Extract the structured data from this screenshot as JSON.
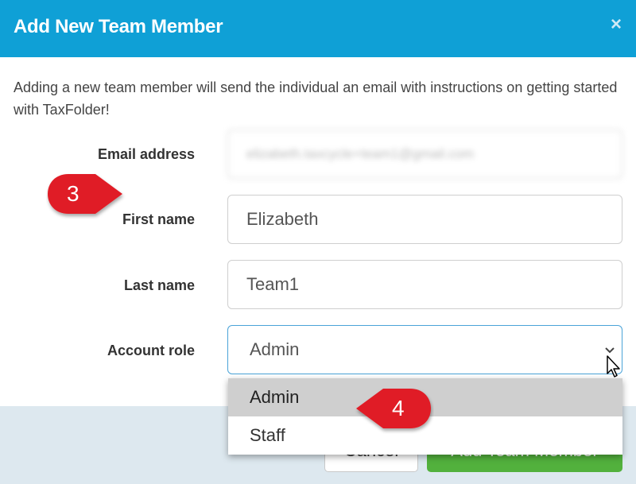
{
  "dialog": {
    "title": "Add New Team Member",
    "close_icon": "×",
    "intro": "Adding a new team member will send the individual an email with instructions on getting started with TaxFolder!"
  },
  "form": {
    "email": {
      "label": "Email address",
      "value": "elizabeth.taxcycle+team1@gmail.com"
    },
    "first_name": {
      "label": "First name",
      "value": "Elizabeth"
    },
    "last_name": {
      "label": "Last name",
      "value": "Team1"
    },
    "account_role": {
      "label": "Account role",
      "value": "Admin",
      "options": [
        "Admin",
        "Staff"
      ]
    }
  },
  "footer": {
    "cancel_label": "Cancel",
    "add_label": "Add Team Member"
  },
  "callouts": [
    {
      "label": "3"
    },
    {
      "label": "4"
    }
  ],
  "colors": {
    "header": "#0fa0d6",
    "add_button": "#52b13d",
    "callout": "#e01f26",
    "footer": "#dde8ef"
  },
  "icons": {
    "close": "close-icon",
    "chevron": "chevron-down-icon",
    "cursor": "mouse-pointer-icon"
  }
}
